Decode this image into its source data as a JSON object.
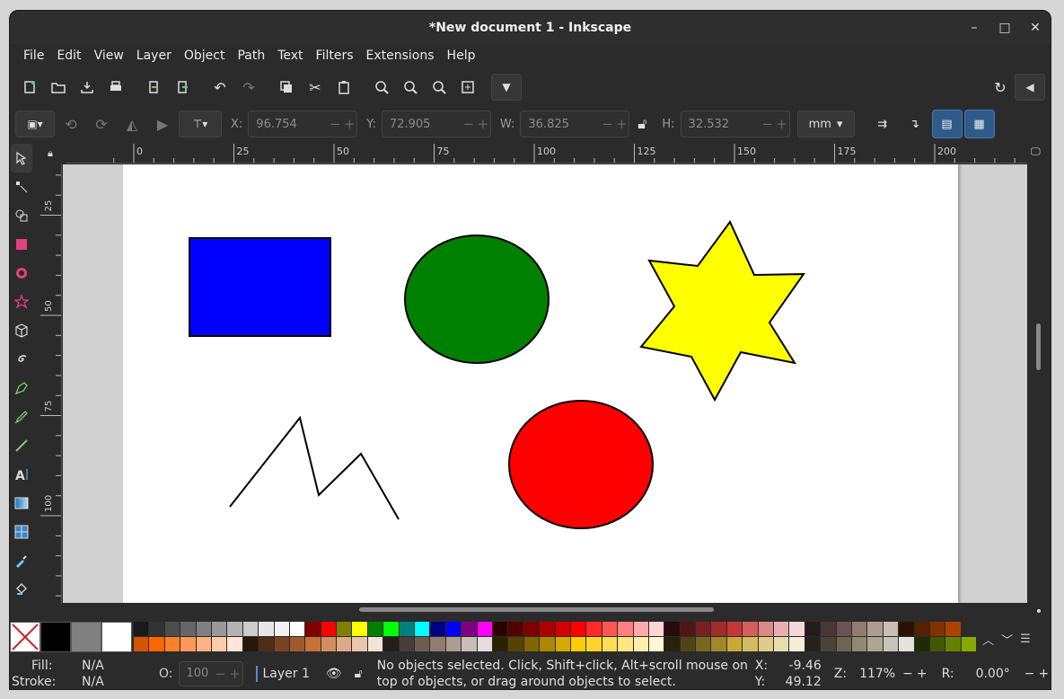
{
  "window": {
    "title": "*New document 1 - Inkscape",
    "minimize": "–",
    "maximize": "□",
    "close": "✕"
  },
  "menu": [
    "File",
    "Edit",
    "View",
    "Layer",
    "Object",
    "Path",
    "Text",
    "Filters",
    "Extensions",
    "Help"
  ],
  "controls": {
    "x_label": "X:",
    "x_value": "96.754",
    "y_label": "Y:",
    "y_value": "72.905",
    "w_label": "W:",
    "w_value": "36.825",
    "h_label": "H:",
    "h_value": "32.532",
    "unit": "mm"
  },
  "rulers": {
    "h_ticks": [
      "0",
      "25",
      "50",
      "75",
      "100",
      "125",
      "150",
      "175",
      "200",
      "2"
    ],
    "v_ticks": [
      "25",
      "50",
      "75",
      "100"
    ]
  },
  "canvas_shapes": [
    {
      "kind": "rectangle",
      "fill": "#0000ff"
    },
    {
      "kind": "ellipse",
      "fill": "#008000"
    },
    {
      "kind": "star",
      "fill": "#ffff00"
    },
    {
      "kind": "polyline",
      "fill": "none"
    },
    {
      "kind": "ellipse",
      "fill": "#ff0000"
    }
  ],
  "palette": {
    "row1": [
      "#1a1a1a",
      "#333333",
      "#4d4d4d",
      "#666666",
      "#808080",
      "#999999",
      "#b3b3b3",
      "#cccccc",
      "#e6e6e6",
      "#f2f2f2",
      "#ffffff",
      "#800000",
      "#ff0000",
      "#808000",
      "#ffff00",
      "#008000",
      "#00ff00",
      "#008080",
      "#00ffff",
      "#000080",
      "#0000ff",
      "#800080",
      "#ff00ff",
      "#2b0000",
      "#550000",
      "#800000",
      "#aa0000",
      "#d40000",
      "#ff0000",
      "#ff2a2a",
      "#ff5555",
      "#ff8080",
      "#ffaaaa",
      "#ffd5d5",
      "#280b0b",
      "#501616",
      "#782121",
      "#a02c2c",
      "#c83737",
      "#d35f5f",
      "#de8787",
      "#e9afaf",
      "#f4d7d7",
      "#241c1c",
      "#483737",
      "#6c5353",
      "#917c6f",
      "#ac9d93",
      "#c8beb7",
      "#2b1100",
      "#552200",
      "#803300",
      "#aa4400"
    ],
    "row2": [
      "#d45500",
      "#ff6600",
      "#ff7f2a",
      "#ff9955",
      "#ffb380",
      "#ffccaa",
      "#ffe6d5",
      "#28170b",
      "#502d16",
      "#784421",
      "#a05a2c",
      "#c87137",
      "#d38d5f",
      "#deaa87",
      "#e9c6af",
      "#f4e3d7",
      "#241f1c",
      "#483e37",
      "#6c5d53",
      "#917c6f",
      "#ac9d93",
      "#c8beb7",
      "#e3dedb",
      "#2b2200",
      "#554400",
      "#806600",
      "#aa8800",
      "#d4aa00",
      "#ffcc00",
      "#ffd42a",
      "#ffdd55",
      "#ffe680",
      "#ffeeaa",
      "#fff6d5",
      "#28220b",
      "#504416",
      "#786721",
      "#a0892c",
      "#c8ab37",
      "#d3bc5f",
      "#decd87",
      "#e9ddaf",
      "#f4eed7",
      "#24221c",
      "#484537",
      "#6c6753",
      "#918a6f",
      "#aca793",
      "#c8c4b7",
      "#e3e2db",
      "#222b00",
      "#445500",
      "#668000",
      "#88aa00"
    ]
  },
  "status": {
    "fill_label": "Fill:",
    "fill_value": "N/A",
    "stroke_label": "Stroke:",
    "stroke_value": "N/A",
    "opacity_label": "O:",
    "opacity_value": "100",
    "layer": "Layer 1",
    "message": "No objects selected. Click, Shift+click, Alt+scroll mouse on top of objects, or drag around objects to select.",
    "x_label": "X:",
    "x_value": "-9.46",
    "y_label": "Y:",
    "y_value": "49.12",
    "zoom_label": "Z:",
    "zoom_value": "117%",
    "rotation_label": "R:",
    "rotation_value": "0.00°"
  },
  "colors": {
    "accent": "#2f5b8a",
    "bg": "#2b2b2b",
    "canvas": "#d1d1d1"
  }
}
